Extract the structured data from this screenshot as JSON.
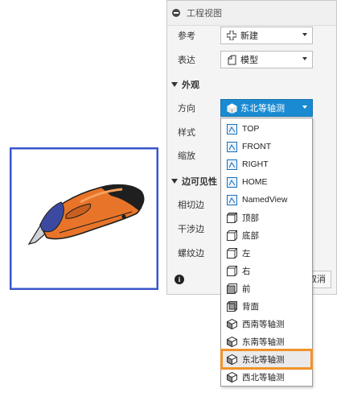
{
  "panel": {
    "title": "工程视图",
    "reference": {
      "label": "参考",
      "value": "新建",
      "icon": "plus-icon"
    },
    "representation": {
      "label": "表达",
      "value": "模型",
      "icon": "model-icon"
    },
    "appearance_section": "外观",
    "orientation": {
      "label": "方向",
      "value": "东北等轴测",
      "icon": "isometric-view-icon"
    },
    "style_label": "样式",
    "scale_label": "缩放",
    "edge_visibility_section": "边可见性",
    "tangent_edges_label": "相切边",
    "interference_edges_label": "干涉边",
    "thread_edges_label": "螺纹边",
    "cancel_label": "取消"
  },
  "dropdown": {
    "options": [
      {
        "label": "TOP",
        "icon": "named-view-icon"
      },
      {
        "label": "FRONT",
        "icon": "named-view-icon"
      },
      {
        "label": "RIGHT",
        "icon": "named-view-icon"
      },
      {
        "label": "HOME",
        "icon": "named-view-icon"
      },
      {
        "label": "NamedView",
        "icon": "named-view-icon"
      },
      {
        "label": "顶部",
        "icon": "cube-top-icon"
      },
      {
        "label": "底部",
        "icon": "cube-bottom-icon"
      },
      {
        "label": "左",
        "icon": "cube-left-icon"
      },
      {
        "label": "右",
        "icon": "cube-right-icon"
      },
      {
        "label": "前",
        "icon": "cube-front-icon"
      },
      {
        "label": "背面",
        "icon": "cube-back-icon"
      },
      {
        "label": "西南等轴测",
        "icon": "isometric-view-icon"
      },
      {
        "label": "东南等轴测",
        "icon": "isometric-view-icon"
      },
      {
        "label": "东北等轴测",
        "icon": "isometric-view-icon"
      },
      {
        "label": "西北等轴测",
        "icon": "isometric-view-icon"
      }
    ],
    "selected_label": "东北等轴测"
  },
  "colors": {
    "accent_blue": "#1a8ad3",
    "highlight_orange": "#f0922e",
    "preview_border": "#3a55c8",
    "knife_orange": "#e8742a",
    "knife_navy": "#3b4aa0"
  }
}
